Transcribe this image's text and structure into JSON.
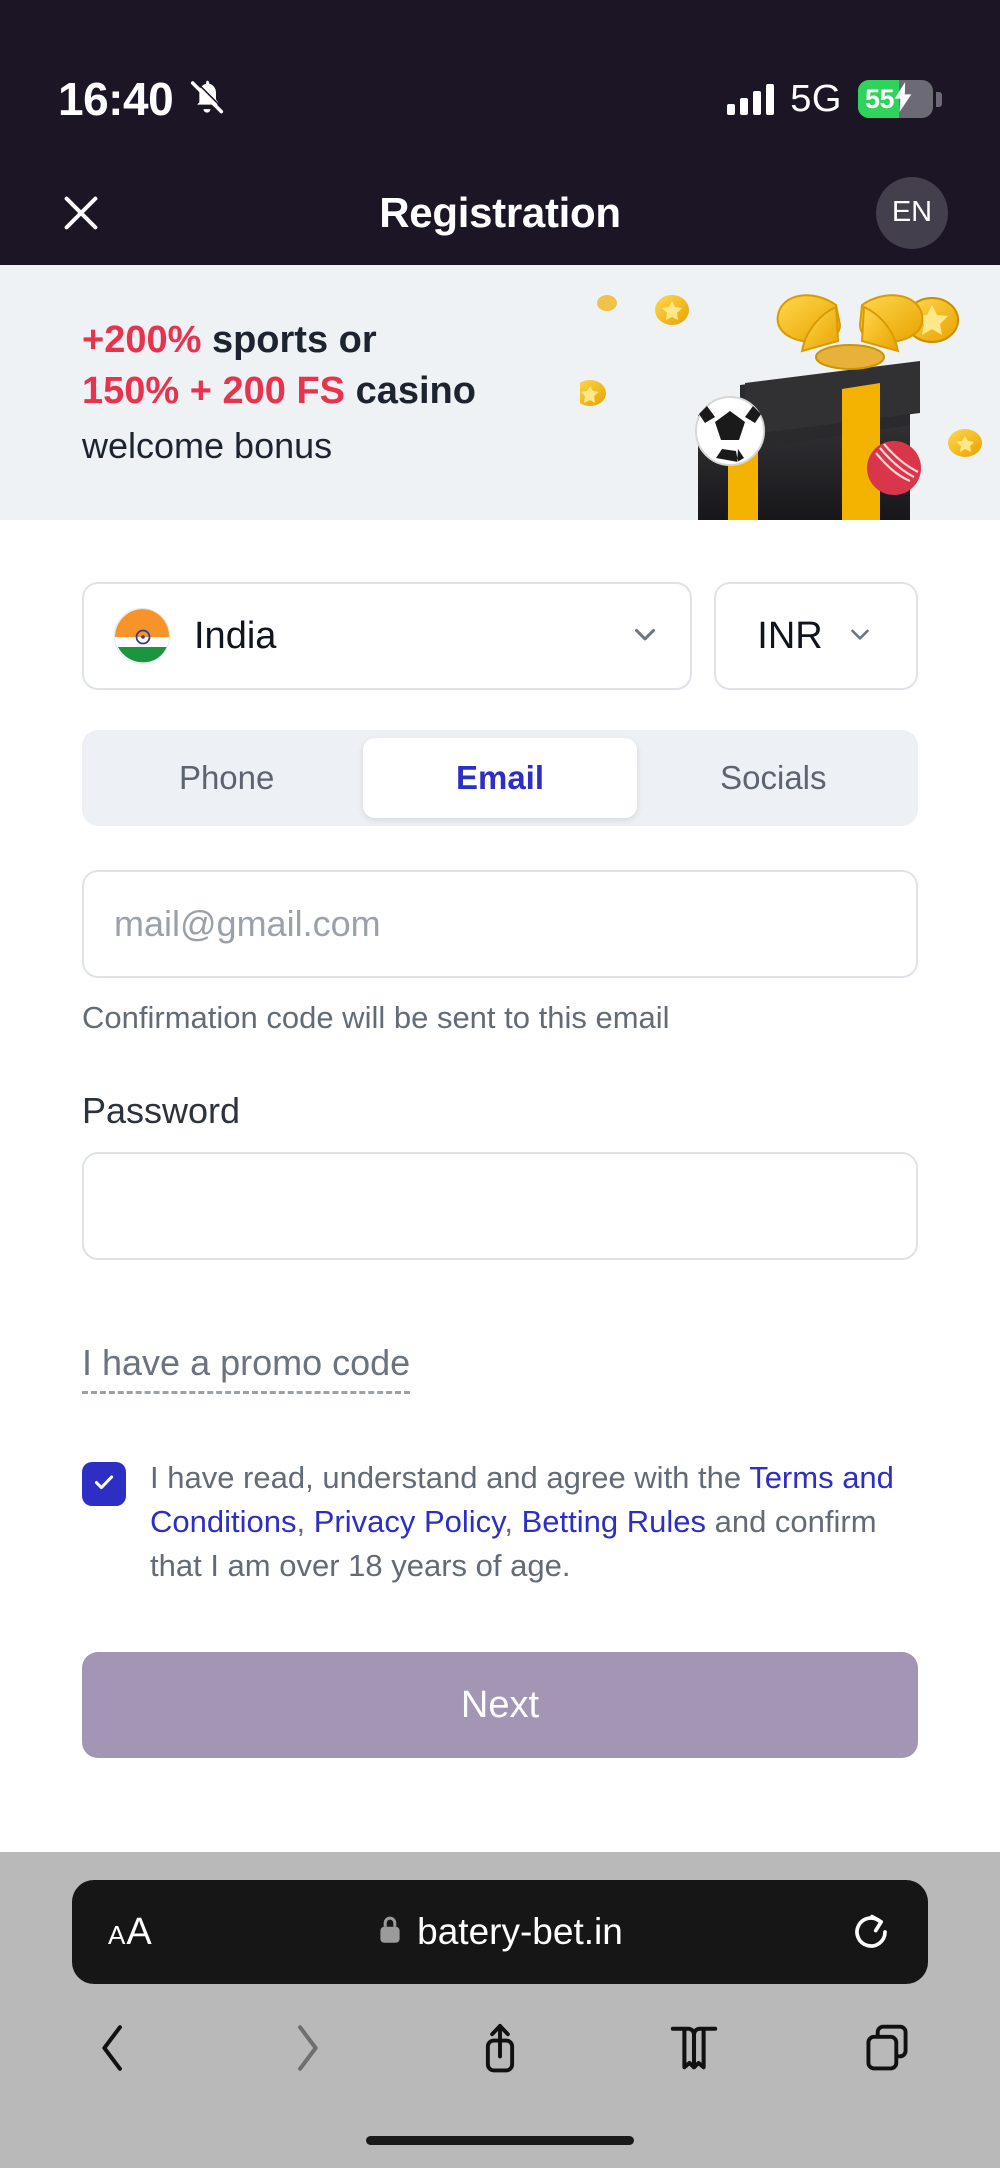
{
  "status_bar": {
    "time": "16:40",
    "mute_icon": "bell-muted-icon",
    "signal_icon": "cellular-signal-icon",
    "network": "5G",
    "battery_percent": "55",
    "battery_level": 55,
    "battery_charging": true,
    "battery_color": "#2ed35c"
  },
  "header": {
    "close_icon": "close-icon",
    "title": "Registration",
    "language": "EN"
  },
  "banner": {
    "line1_accent": "+200%",
    "line1_rest": " sports or",
    "line2_accent": "150% + 200 FS",
    "line2_rest": " casino",
    "subtitle": "welcome bonus",
    "accent_color": "#e8334f",
    "background_color": "#eef2f4",
    "art": "gift-box-with-coins-illustration"
  },
  "form": {
    "country": {
      "label": "India",
      "flag": "india-flag-icon",
      "chevron": "chevron-down-icon"
    },
    "currency": {
      "label": "INR",
      "chevron": "chevron-down-icon"
    },
    "tabs": [
      {
        "label": "Phone",
        "active": false
      },
      {
        "label": "Email",
        "active": true
      },
      {
        "label": "Socials",
        "active": false
      }
    ],
    "active_tab_color": "#2d2ec4",
    "email": {
      "value": "",
      "placeholder": "mail@gmail.com",
      "helper": "Confirmation code will be sent to this email"
    },
    "password": {
      "label": "Password",
      "value": "",
      "placeholder": ""
    },
    "promo_link": "I have a promo code",
    "terms": {
      "checked": true,
      "check_icon": "checkmark-icon",
      "part1": "I have read, understand and agree with the ",
      "link1": "Terms and Conditions",
      "sep1": ", ",
      "link2": "Privacy Policy",
      "sep2": ", ",
      "link3": "Betting Rules",
      "part2": " and confirm that I am over 18 years of age."
    },
    "submit_label": "Next",
    "submit_color": "#a396b4"
  },
  "browser": {
    "text_size_small": "A",
    "text_size_large": "A",
    "lock_icon": "lock-icon",
    "url": "batery-bet.in",
    "reload_icon": "reload-icon",
    "toolbar": [
      {
        "name": "back-button",
        "icon": "chevron-left-icon",
        "enabled": true
      },
      {
        "name": "forward-button",
        "icon": "chevron-right-icon",
        "enabled": false
      },
      {
        "name": "share-button",
        "icon": "share-icon",
        "enabled": true
      },
      {
        "name": "bookmarks-button",
        "icon": "book-icon",
        "enabled": true
      },
      {
        "name": "tabs-button",
        "icon": "tabs-icon",
        "enabled": true
      }
    ]
  }
}
